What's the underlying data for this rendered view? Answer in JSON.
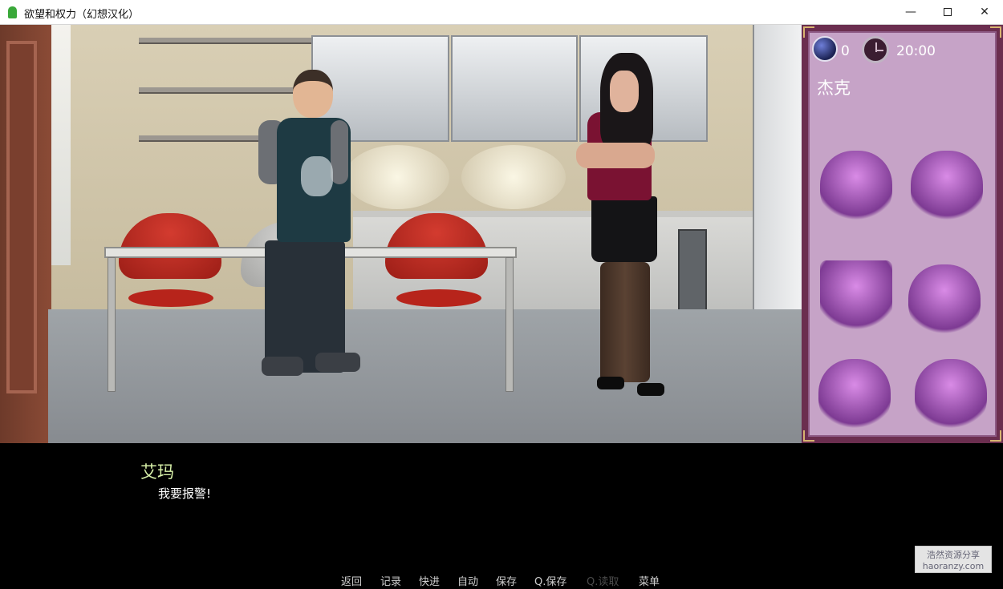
{
  "window": {
    "title": "欲望和权力（幻想汉化）",
    "minimize": "—",
    "close": "✕"
  },
  "hud": {
    "yin_icon": "yin-yang-moon-icon",
    "points": "0",
    "clock_icon": "clock-icon",
    "time": "20:00",
    "character_name": "杰克",
    "portrait_slots": 6
  },
  "dialogue": {
    "speaker": "艾玛",
    "text": "我要报警!"
  },
  "quick_menu": [
    {
      "label": "返回",
      "enabled": true
    },
    {
      "label": "记录",
      "enabled": true
    },
    {
      "label": "快进",
      "enabled": true
    },
    {
      "label": "自动",
      "enabled": true
    },
    {
      "label": "保存",
      "enabled": true
    },
    {
      "label": "Q.保存",
      "enabled": true
    },
    {
      "label": "Q.读取",
      "enabled": false
    },
    {
      "label": "菜单",
      "enabled": true
    }
  ],
  "watermark": {
    "line1": "浩然资源分享",
    "line2": "haoranzy.com"
  },
  "colors": {
    "speaker": "#d8f1a9",
    "panel_frame": "#6b2e4f",
    "panel_bg": "#c6a3c7"
  }
}
